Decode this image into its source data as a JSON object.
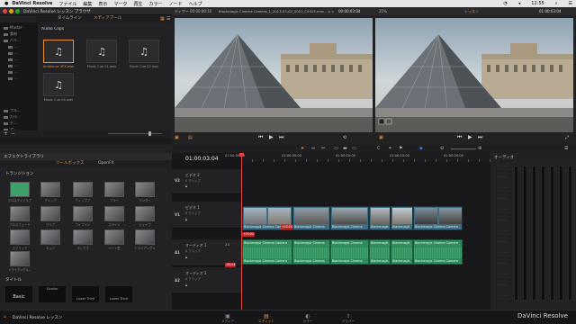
{
  "menubar": {
    "app": "DaVinci Resolve",
    "menus": [
      "ファイル",
      "編集",
      "表示",
      "マーク",
      "再生",
      "カラー",
      "ノード",
      "ヘルプ"
    ],
    "clock": "12:55"
  },
  "media_panel": {
    "title": "DaVinci Resolve レッスン ブラウザ",
    "tabs": [
      "タイムライン",
      "メディアプール"
    ],
    "active_tab": 1,
    "bin_title": "Audio Clips",
    "tree": [
      "Master",
      "素材",
      "バリ...",
      "...",
      "...",
      "...",
      "...",
      "...",
      "...",
      "フル...",
      "カラ...",
      "テ...",
      "ア...",
      "...",
      "..."
    ],
    "clips": [
      {
        "label": "Ambience 4FX.wav",
        "selected": true
      },
      {
        "label": "Music Cue 01.wav",
        "selected": false
      },
      {
        "label": "Music Cue 02.wav",
        "selected": false
      },
      {
        "label": "Music Cue 04.wav",
        "selected": false
      }
    ]
  },
  "source_viewer": {
    "mode": "ディザー",
    "timecode_left": "00:00:00:10",
    "clip_name": "Blackmagic Cinema Camera_1_2013-03-02_0001_C0013.mov - レッスン",
    "timecode_right": "00:00:03:04"
  },
  "program_viewer": {
    "zoom": "25%",
    "timecode_label": "レッスン",
    "timecode": "01:00:03:04"
  },
  "effects": {
    "title": "エフェクトライブラリ",
    "tabs": [
      "ツールボックス",
      "OpenFX"
    ],
    "active_tab": 0,
    "section_transitions": "トランジション",
    "items": [
      "クロスディゾルブ",
      "ディップ",
      "ディッププ",
      "ブラー",
      "ランダー",
      "クロスフェード",
      "ワイプ",
      "ワイプイン",
      "スライド",
      "シェイプ",
      "スプリット",
      "エッジ",
      "ボックス",
      "ハート型",
      "トライアングル",
      "ワンダー",
      "トライアングル..."
    ],
    "section_titles": "タイトル",
    "title_items": [
      "Basic",
      "Scroller",
      "Lower Third",
      "Lower Third"
    ]
  },
  "timeline": {
    "timecode": "01:00:03:04",
    "ruler": [
      "01:00:00:00",
      "01:00:05:00",
      "01:00:10:00",
      "01:00:15:00",
      "01:00:20:00",
      "01:00:25:00"
    ],
    "tracks": [
      {
        "id": "V2",
        "name": "ビデオ 2",
        "clips": "0 クリップ"
      },
      {
        "id": "V1",
        "name": "ビデオ 1",
        "clips": "6 クリップ"
      },
      {
        "id": "A1",
        "name": "オーディオ 1",
        "clips": "6 クリップ",
        "level": "2.0"
      },
      {
        "id": "A2",
        "name": "オーディオ 2",
        "clips": "0 クリップ"
      }
    ],
    "video_clips": [
      {
        "label": "Blackmagic Cinema Camera",
        "tc": "+03:04"
      },
      {
        "label": "Blackmagic Cinema",
        "tc": ""
      },
      {
        "label": "Blackmagic Cinema",
        "tc": ""
      },
      {
        "label": "Blackmagic",
        "tc": ""
      },
      {
        "label": "Blackmagic",
        "tc": ""
      },
      {
        "label": "Blackmagic Cinema Camera",
        "tc": ""
      }
    ],
    "audio_clips": [
      {
        "label": "Blackmagic Cinema Camera",
        "tc": "+03:04"
      },
      {
        "label": "Blackmagic Cinema",
        "tc": ""
      },
      {
        "label": "Blackmagic Cinema",
        "tc": ""
      },
      {
        "label": "Blackmagic",
        "tc": ""
      },
      {
        "label": "Blackmagic",
        "tc": ""
      },
      {
        "label": "Blackmagic Cinema Camera",
        "tc": ""
      }
    ],
    "playhead_tc": "-00:04"
  },
  "audio_panel": {
    "title": "オーディオ"
  },
  "bottom": {
    "app_label": "DaVinci Resolve レッスン",
    "pages": [
      "メディア",
      "エディット",
      "カラー",
      "デリバー"
    ],
    "active_page": 1,
    "brand": "DaVinci Resolve"
  }
}
